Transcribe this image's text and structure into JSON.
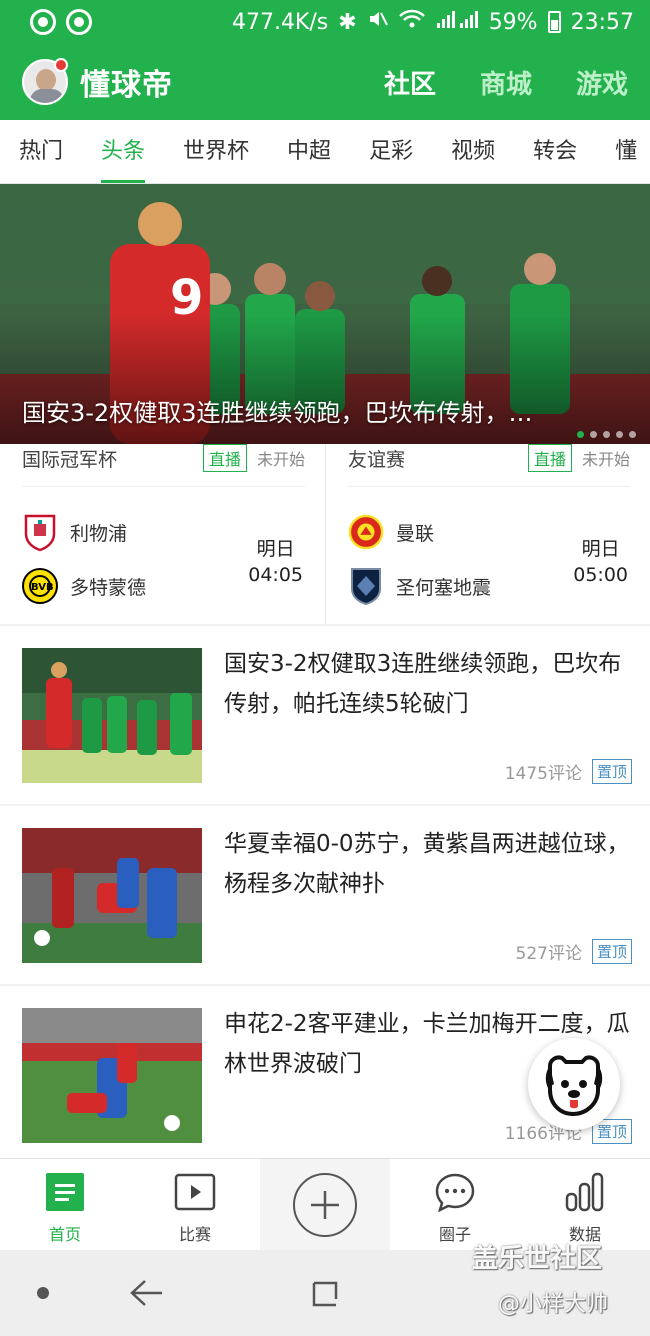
{
  "status_bar": {
    "speed": "477.4K/s",
    "battery": "59%",
    "time": "23:57",
    "icons": [
      "bluetooth-icon",
      "mute-icon",
      "wifi-icon",
      "signal-icon",
      "battery-icon"
    ]
  },
  "header": {
    "logo": "懂球帝",
    "tabs": [
      {
        "label": "社区",
        "active": true
      },
      {
        "label": "商城",
        "active": false
      },
      {
        "label": "游戏",
        "active": false
      }
    ]
  },
  "category_tabs": [
    "热门",
    "头条",
    "世界杯",
    "中超",
    "足彩",
    "视频",
    "转会",
    "懂"
  ],
  "active_category": "头条",
  "banner": {
    "caption": "国安3-2权健取3连胜继续领跑，巴坎布传射，…",
    "dots": 5,
    "active_dot": 0
  },
  "matches": [
    {
      "league": "国际冠军杯",
      "live_label": "直播",
      "status": "未开始",
      "team1": "利物浦",
      "team2": "多特蒙德",
      "day": "明日",
      "time": "04:05"
    },
    {
      "league": "友谊赛",
      "live_label": "直播",
      "status": "未开始",
      "team1": "曼联",
      "team2": "圣何塞地震",
      "day": "明日",
      "time": "05:00"
    }
  ],
  "news": [
    {
      "title": "国安3-2权健取3连胜继续领跑，巴坎布传射，帕托连续5轮破门",
      "comments": "1475评论",
      "badge": "置顶"
    },
    {
      "title": "华夏幸福0-0苏宁，黄紫昌两进越位球，杨程多次献神扑",
      "comments": "527评论",
      "badge": "置顶"
    },
    {
      "title": "申花2-2客平建业，卡兰加梅开二度，瓜林世界波破门",
      "comments": "1166评论",
      "badge": "置顶"
    }
  ],
  "bottom_nav": [
    {
      "label": "首页",
      "icon": "home-icon",
      "active": true
    },
    {
      "label": "比赛",
      "icon": "play-icon",
      "active": false
    },
    {
      "label": "",
      "icon": "plus-icon",
      "active": false
    },
    {
      "label": "圈子",
      "icon": "chat-icon",
      "active": false
    },
    {
      "label": "数据",
      "icon": "bar-chart-icon",
      "active": false
    }
  ],
  "watermark": {
    "line1": "盖乐世社区",
    "line2": "@小样大帅"
  },
  "colors": {
    "brand_green": "#22b14c",
    "pin_blue": "#4a90c2"
  }
}
